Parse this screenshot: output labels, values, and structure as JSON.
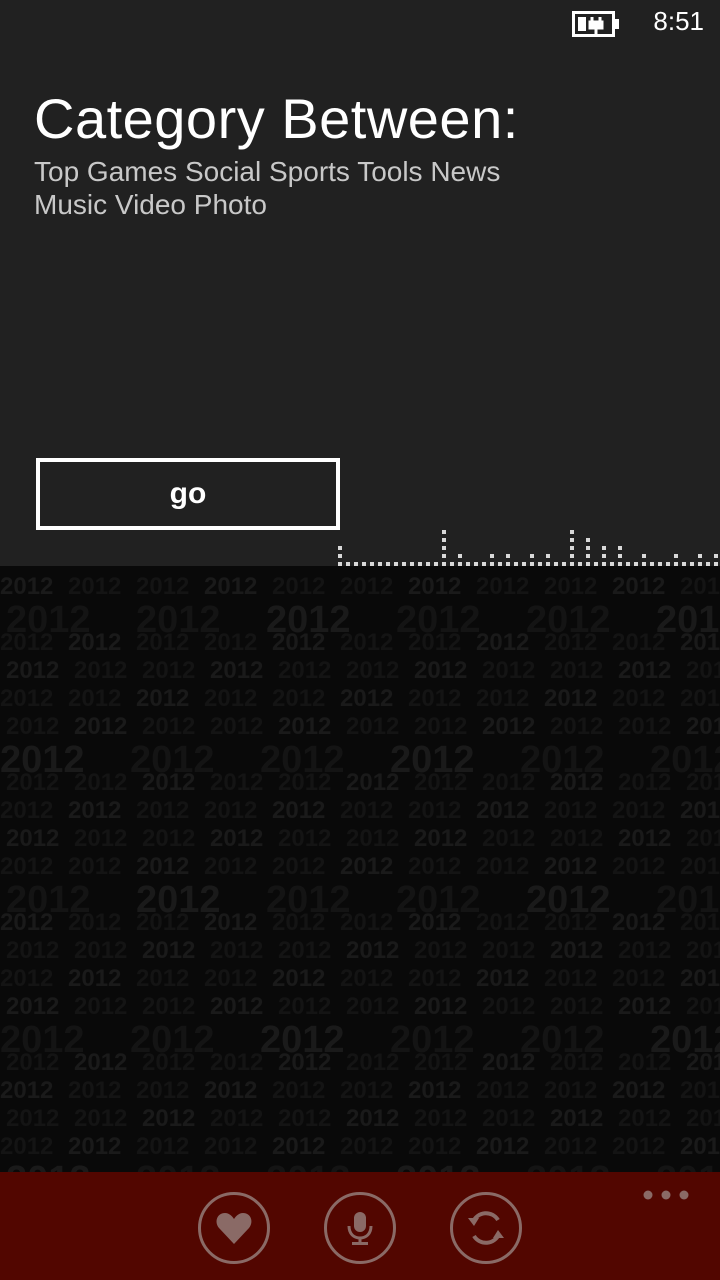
{
  "status_bar": {
    "battery_icon": "battery-charging-icon",
    "time": "8:51"
  },
  "main": {
    "title": "Category Between:",
    "categories_text": " Top Games Social Sports Tools News Music Video Photo",
    "go_label": "go"
  },
  "background": {
    "watermark_text": "2012"
  },
  "app_bar": {
    "buttons": [
      {
        "icon": "heart-icon"
      },
      {
        "icon": "microphone-icon"
      },
      {
        "icon": "refresh-icon"
      }
    ],
    "more_icon": "more-dots-icon",
    "color": "#520600"
  }
}
